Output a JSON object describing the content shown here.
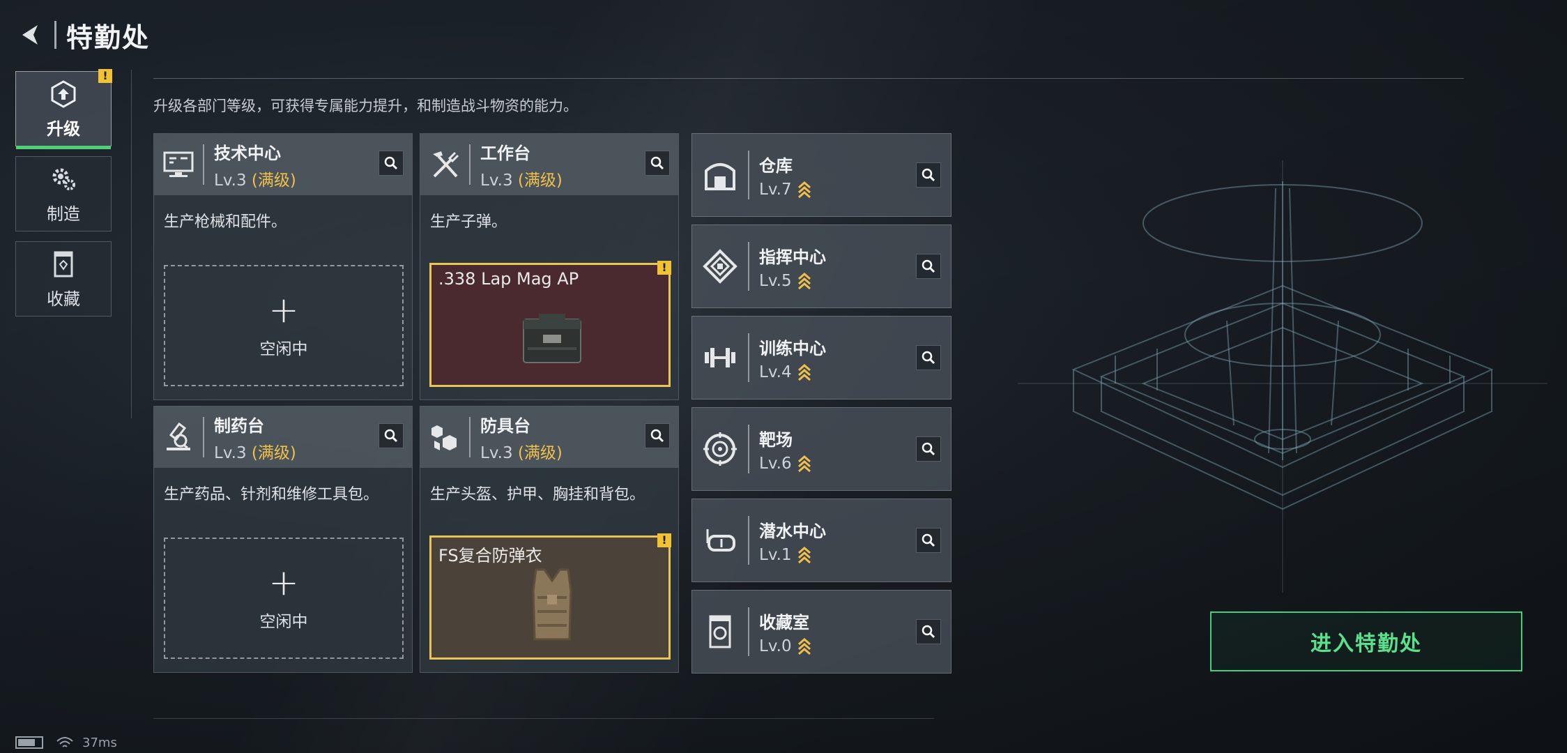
{
  "header": {
    "title": "特勤处"
  },
  "nav": [
    {
      "label": "升级",
      "active": true,
      "warning": "!"
    },
    {
      "label": "制造",
      "active": false
    },
    {
      "label": "收藏",
      "active": false
    }
  ],
  "description": "升级各部门等级，可获得专属能力提升，和制造战斗物资的能力。",
  "departments": [
    {
      "name": "技术中心",
      "lv": "Lv.3",
      "max": "(满级)",
      "desc": "生产枪械和配件。",
      "slot": {
        "type": "idle",
        "plus": "+",
        "label": "空闲中"
      }
    },
    {
      "name": "工作台",
      "lv": "Lv.3",
      "max": "(满级)",
      "desc": "生产子弹。",
      "slot": {
        "type": "product",
        "name": ".338 Lap Mag AP",
        "warning": "!"
      }
    },
    {
      "name": "制药台",
      "lv": "Lv.3",
      "max": "(满级)",
      "desc": "生产药品、针剂和维修工具包。",
      "slot": {
        "type": "idle",
        "plus": "+",
        "label": "空闲中"
      }
    },
    {
      "name": "防具台",
      "lv": "Lv.3",
      "max": "(满级)",
      "desc": "生产头盔、护甲、胸挂和背包。",
      "slot": {
        "type": "product",
        "name": "FS复合防弹衣",
        "warning": "!"
      }
    }
  ],
  "facilities": [
    {
      "name": "仓库",
      "lv": "Lv.7",
      "icon": "warehouse-icon"
    },
    {
      "name": "指挥中心",
      "lv": "Lv.5",
      "icon": "command-center-icon"
    },
    {
      "name": "训练中心",
      "lv": "Lv.4",
      "icon": "dumbbell-icon"
    },
    {
      "name": "靶场",
      "lv": "Lv.6",
      "icon": "target-icon"
    },
    {
      "name": "潜水中心",
      "lv": "Lv.1",
      "icon": "diving-mask-icon"
    },
    {
      "name": "收藏室",
      "lv": "Lv.0",
      "icon": "collection-icon"
    }
  ],
  "enter_button": "进入特勤处",
  "status": {
    "ping": "37ms"
  },
  "colors": {
    "accent_green": "#3ed37a",
    "gold": "#f0c04a",
    "warning": "#f1c232",
    "product_red": "#4a2a2e",
    "product_brown": "#4b4339"
  }
}
